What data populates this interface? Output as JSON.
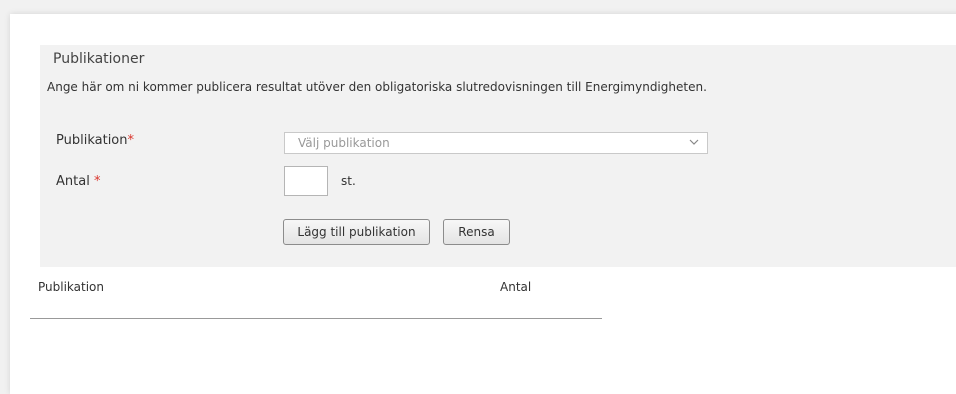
{
  "section": {
    "title": "Publikationer",
    "description": "Ange här om ni kommer publicera resultat utöver den obligatoriska slutredovisningen till Energimyndigheten."
  },
  "form": {
    "publication_label": "Publikation",
    "publication_required": "*",
    "publication_placeholder": "Välj publikation",
    "count_label": "Antal",
    "count_required": "*",
    "count_value": "",
    "count_unit": "st.",
    "add_button": "Lägg till publikation",
    "clear_button": "Rensa"
  },
  "table": {
    "columns": [
      "Publikation",
      "Antal"
    ],
    "rows": []
  },
  "colors": {
    "required": "#d9342b",
    "form_background": "#f2f2f2"
  },
  "icons": {
    "select_arrow": "chevron-down-icon"
  }
}
